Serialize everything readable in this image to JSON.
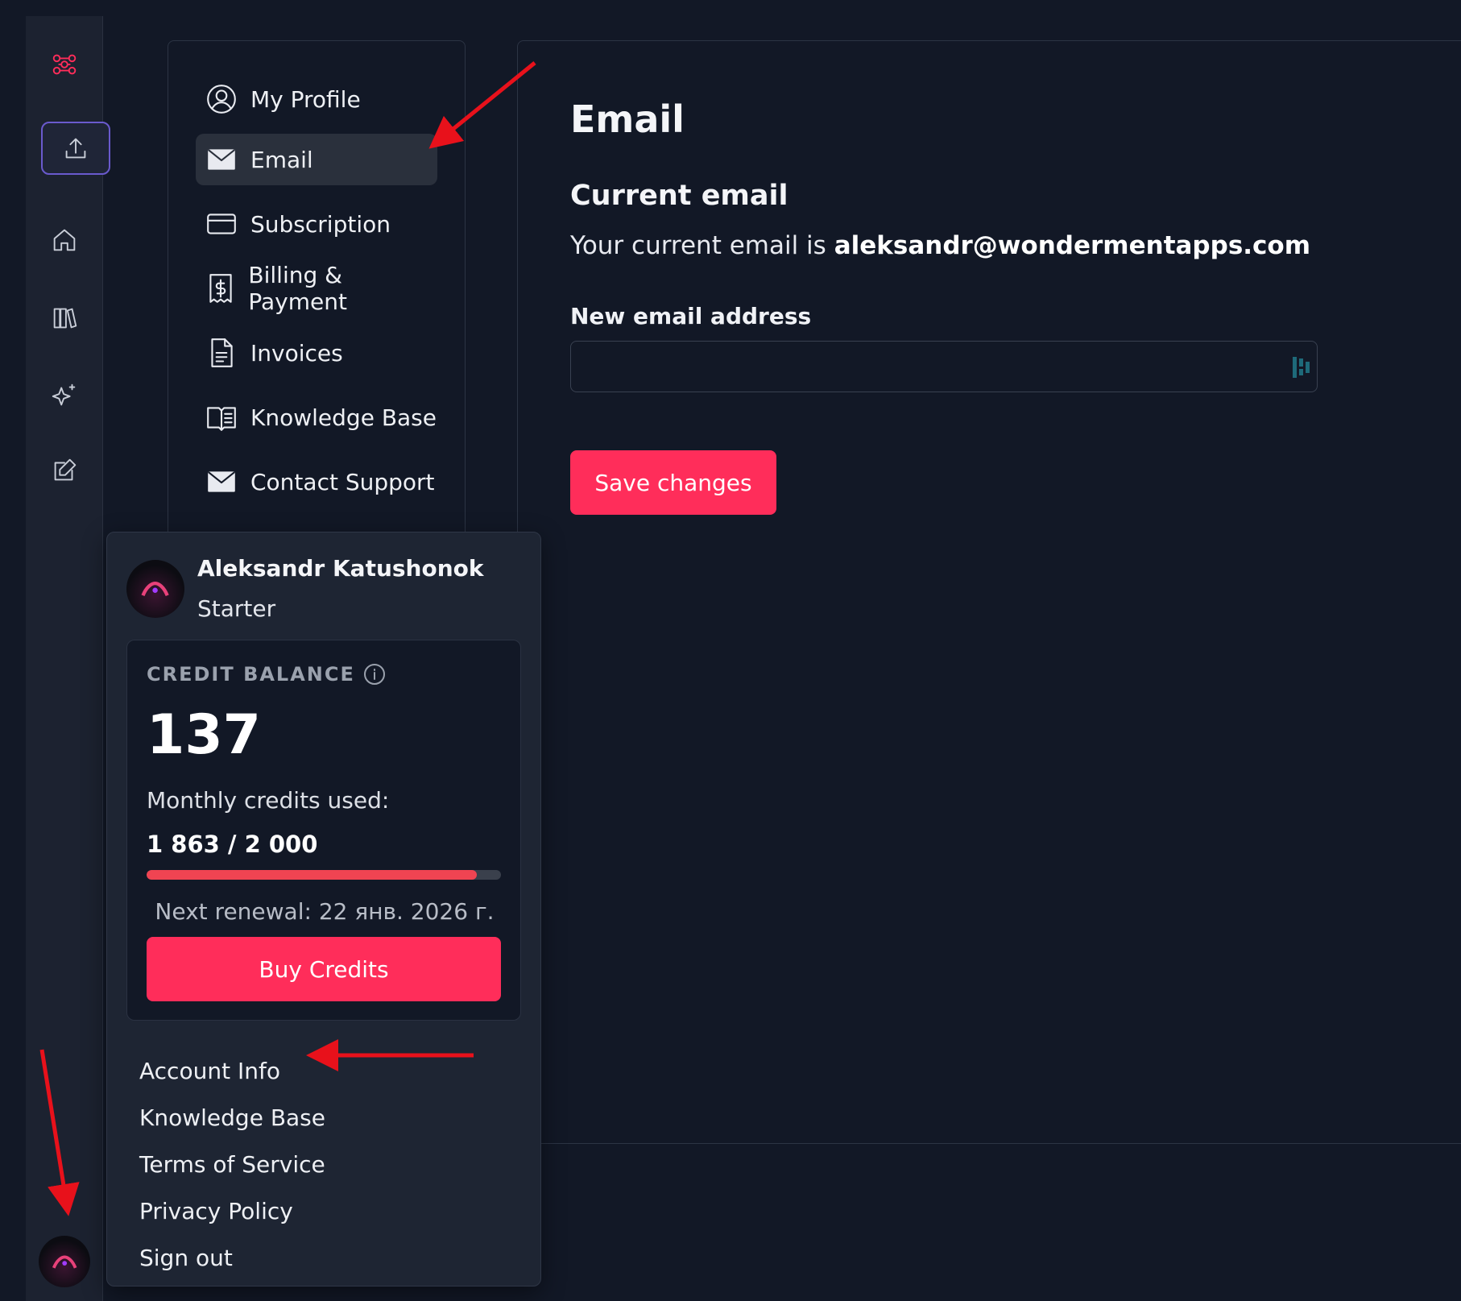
{
  "rail": {
    "items": [
      {
        "icon": "logo-icon"
      },
      {
        "icon": "upload-icon"
      },
      {
        "icon": "home-icon"
      },
      {
        "icon": "library-icon"
      },
      {
        "icon": "sparkle-icon"
      },
      {
        "icon": "edit-icon"
      },
      {
        "icon": "avatar"
      }
    ]
  },
  "settings_nav": {
    "items": [
      {
        "label": "My Profile",
        "icon": "user-circle-icon"
      },
      {
        "label": "Email",
        "icon": "envelope-icon",
        "active": true
      },
      {
        "label": "Subscription",
        "icon": "credit-card-icon"
      },
      {
        "label": "Billing & Payment",
        "icon": "receipt-dollar-icon"
      },
      {
        "label": "Invoices",
        "icon": "document-icon"
      },
      {
        "label": "Knowledge Base",
        "icon": "book-icon"
      },
      {
        "label": "Contact Support",
        "icon": "envelope-icon"
      }
    ]
  },
  "main": {
    "title": "Email",
    "current_heading": "Current email",
    "current_prefix": "Your current email is",
    "current_email": "aleksandr@wondermentapps.com",
    "new_label": "New email address",
    "new_value": "",
    "save_label": "Save changes"
  },
  "popup": {
    "user_name": "Aleksandr Katushonok",
    "plan": "Starter",
    "credit_label": "CREDIT BALANCE",
    "credit_value": "137",
    "monthly_label": "Monthly credits used:",
    "monthly_value": "1 863 / 2 000",
    "monthly_fraction": 0.9315,
    "renewal": "Next renewal: 22 янв. 2026 г.",
    "buy_label": "Buy Credits",
    "links": [
      "Account Info",
      "Knowledge Base",
      "Terms of Service",
      "Privacy Policy",
      "Sign out"
    ]
  },
  "colors": {
    "accent": "#ff2d5a",
    "background": "#121826",
    "panel": "#1e2533",
    "progress": "#f04452",
    "annotation": "#e8111b"
  }
}
